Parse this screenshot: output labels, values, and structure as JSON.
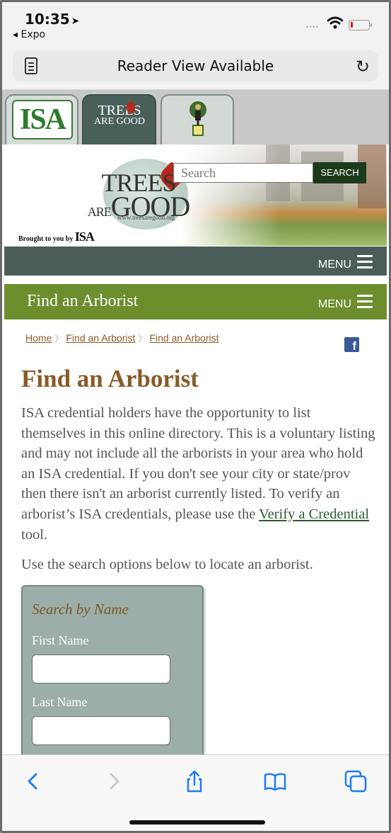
{
  "status": {
    "time": "10:35",
    "back_app": "Expo"
  },
  "browser": {
    "reader_label": "Reader View Available",
    "reader_icon": "reader-page-icon",
    "reload_icon": "reload-icon"
  },
  "site_tabs": [
    {
      "name": "ISA",
      "icon": "isa-logo"
    },
    {
      "name": "Trees Are Good",
      "icon": "trees-are-good-logo",
      "active": true
    },
    {
      "name": "Tree Climber",
      "icon": "tree-climber-logo"
    }
  ],
  "banner": {
    "logo_line1": "TREES",
    "logo_line2": "GOOD",
    "logo_are": "ARE",
    "logo_url": "www.treesaregood.org",
    "brought_by": "Brought to you by",
    "brought_logo": "ISA",
    "search_placeholder": "Search",
    "search_button": "SEARCH"
  },
  "nav": {
    "menu_label": "MENU",
    "section_title": "Find an Arborist",
    "section_menu_label": "MENU"
  },
  "breadcrumb": {
    "items": [
      "Home",
      "Find an Arborist",
      "Find an Arborist"
    ]
  },
  "content": {
    "page_title": "Find an Arborist",
    "intro_text_before_link": "ISA credential holders have the opportunity to list themselves in this online directory. This is a voluntary listing and may not include all the arborists in your area who hold an ISA credential. If you don't see your city or state/prov then there isn't an arborist currently listed. To verify an arborist’s ISA credentials, please use the ",
    "intro_link": "Verify a Credential",
    "intro_text_after_link": " tool.",
    "search_hint": "Use the search options below to locate an arborist."
  },
  "search_panel": {
    "title": "Search by Name",
    "first_name_label": "First Name",
    "first_name_value": "",
    "last_name_label": "Last Name",
    "last_name_value": ""
  },
  "toolbar": {
    "back_icon": "back-chevron-icon",
    "forward_icon": "forward-chevron-icon",
    "share_icon": "share-icon",
    "bookmarks_icon": "bookmarks-book-icon",
    "tabs_icon": "tabs-icon"
  },
  "colors": {
    "nav_dark": "#4a5d59",
    "nav_green": "#6c8e2d",
    "title_brown": "#8a5a27",
    "ios_blue": "#1f7bf6"
  }
}
